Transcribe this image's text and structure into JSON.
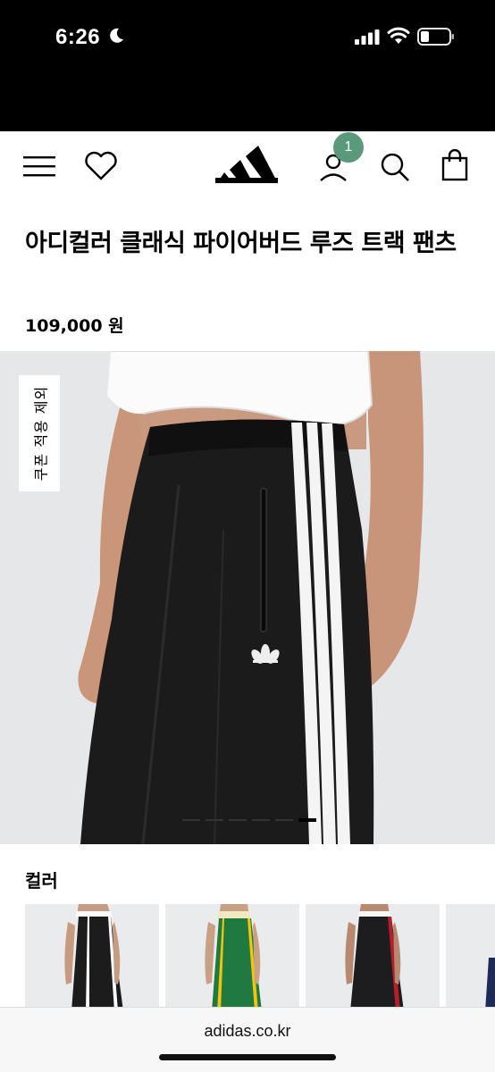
{
  "status_bar": {
    "time": "6:26"
  },
  "header": {
    "account_badge_count": "1"
  },
  "product": {
    "title": "아디컬러 클래식 파이어버드 루즈 트랙 팬츠",
    "price": "109,000 원",
    "coupon_tag": "쿠폰 적용 제외",
    "carousel": {
      "total": 6,
      "active_index": 5
    }
  },
  "colors": {
    "label": "컬러",
    "items": [
      {
        "name": "black-white"
      },
      {
        "name": "green-yellow"
      },
      {
        "name": "black-red"
      },
      {
        "name": "navy"
      }
    ]
  },
  "browser": {
    "url": "adidas.co.kr"
  }
}
